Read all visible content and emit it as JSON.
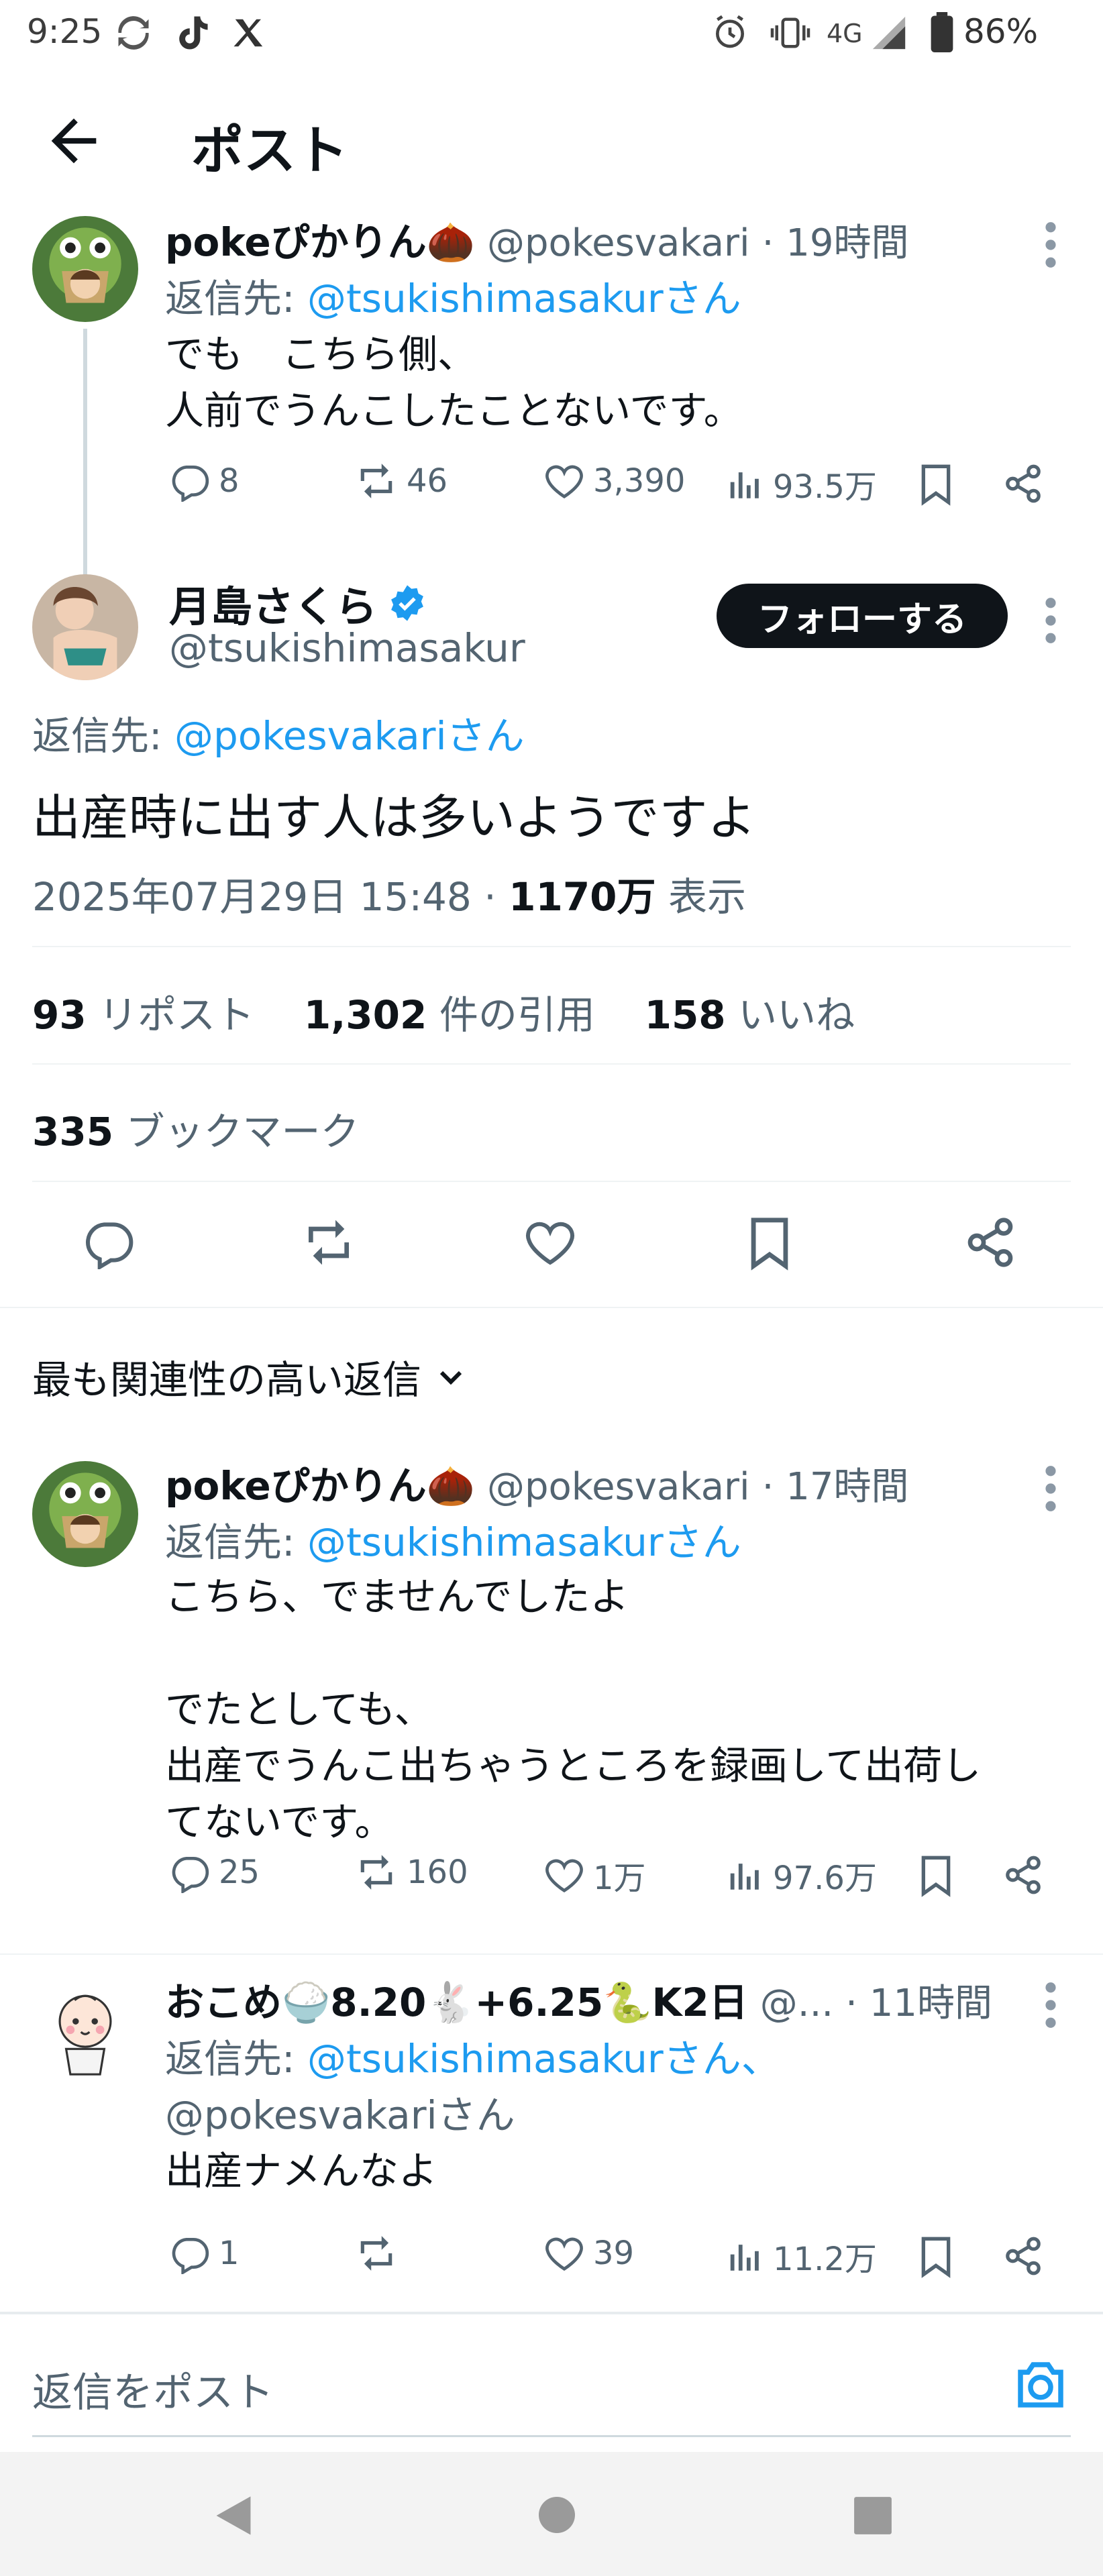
{
  "status_bar": {
    "time": "9:25",
    "network": "4G",
    "battery": "86%"
  },
  "header": {
    "title": "ポスト"
  },
  "parent_post": {
    "name": "pokeぴかりん🌰",
    "handle": "@pokesvakari",
    "time": "· 19時間",
    "reply_to_prefix": "返信先:",
    "reply_to_user": "@tsukishimasakurさん",
    "text": "でも　こちら側、\n人前でうんこしたことないです。",
    "replies": "8",
    "reposts": "46",
    "likes": "3,390",
    "views": "93.5万"
  },
  "main_post": {
    "name": "月島さくら",
    "handle": "@tsukishimasakur",
    "follow_label": "フォローする",
    "reply_to_prefix": "返信先:",
    "reply_to_user": "@pokesvakariさん",
    "text": "出産時に出す人は多いようですよ",
    "timestamp": "2025年07月29日 15:48 ·",
    "views_count": "1170万",
    "views_label": "表示",
    "reposts_count": "93",
    "reposts_label": "リポスト",
    "quotes_count": "1,302",
    "quotes_label": "件の引用",
    "likes_count": "158",
    "likes_label": "いいね",
    "bookmarks_count": "335",
    "bookmarks_label": "ブックマーク"
  },
  "sort": {
    "label": "最も関連性の高い返信"
  },
  "replies": [
    {
      "name": "pokeぴかりん🌰",
      "handle": "@pokesvakari",
      "time": "· 17時間",
      "reply_to_prefix": "返信先:",
      "reply_to_user": "@tsukishimasakurさん",
      "text": "こちら、でませんでしたよ\n\nでたとしても、\n出産でうんこ出ちゃうところを録画して出荷し\nてないです。",
      "replies": "25",
      "reposts": "160",
      "likes": "1万",
      "views": "97.6万"
    },
    {
      "name": "おこめ🍚8.20🐇+6.25🐍K2日",
      "handle": "@...",
      "time": "· 11時間",
      "reply_to_prefix": "返信先:",
      "reply_to_user": "@tsukishimasakurさん、",
      "reply_to_user2": "@pokesvakariさん",
      "text": "出産ナメんなよ",
      "replies": "1",
      "reposts": "",
      "likes": "39",
      "views": "11.2万"
    }
  ],
  "reply_bar": {
    "placeholder": "返信をポスト"
  },
  "colors": {
    "accent": "#1d9bf0",
    "text": "#0f1419",
    "muted": "#536471"
  }
}
